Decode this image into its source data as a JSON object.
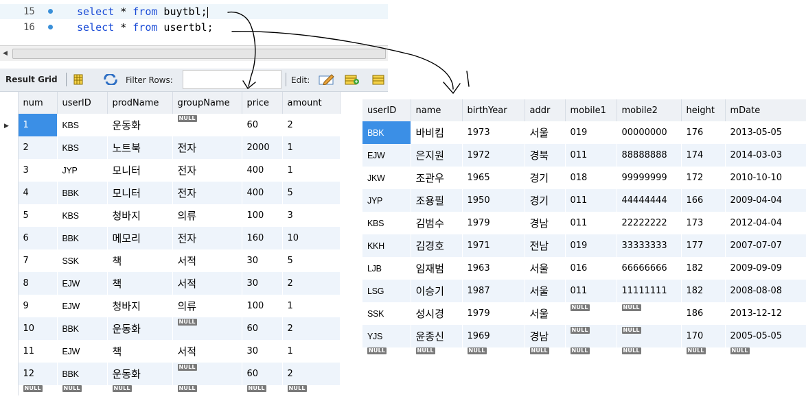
{
  "editor": {
    "lines": [
      {
        "number": "15",
        "keyword": "select",
        "mid": " * ",
        "keyword2": "from",
        "tail": " buytbl;"
      },
      {
        "number": "16",
        "keyword": "select",
        "mid": " * ",
        "keyword2": "from",
        "tail": " usertbl;"
      }
    ]
  },
  "toolbar": {
    "result_grid_label": "Result Grid",
    "filter_rows_label": "Filter Rows:",
    "filter_value": "",
    "edit_label": "Edit:"
  },
  "null_label": "NULL",
  "buytbl": {
    "columns": [
      "num",
      "userID",
      "prodName",
      "groupName",
      "price",
      "amount"
    ],
    "rows": [
      [
        "1",
        "KBS",
        "운동화",
        null,
        "60",
        "2"
      ],
      [
        "2",
        "KBS",
        "노트북",
        "전자",
        "2000",
        "1"
      ],
      [
        "3",
        "JYP",
        "모니터",
        "전자",
        "400",
        "1"
      ],
      [
        "4",
        "BBK",
        "모니터",
        "전자",
        "400",
        "5"
      ],
      [
        "5",
        "KBS",
        "청바지",
        "의류",
        "100",
        "3"
      ],
      [
        "6",
        "BBK",
        "메모리",
        "전자",
        "160",
        "10"
      ],
      [
        "7",
        "SSK",
        "책",
        "서적",
        "30",
        "5"
      ],
      [
        "8",
        "EJW",
        "책",
        "서적",
        "30",
        "2"
      ],
      [
        "9",
        "EJW",
        "청바지",
        "의류",
        "100",
        "1"
      ],
      [
        "10",
        "BBK",
        "운동화",
        null,
        "60",
        "2"
      ],
      [
        "11",
        "EJW",
        "책",
        "서적",
        "30",
        "1"
      ],
      [
        "12",
        "BBK",
        "운동화",
        null,
        "60",
        "2"
      ]
    ]
  },
  "usertbl": {
    "columns": [
      "userID",
      "name",
      "birthYear",
      "addr",
      "mobile1",
      "mobile2",
      "height",
      "mDate"
    ],
    "rows": [
      [
        "BBK",
        "바비킴",
        "1973",
        "서울",
        "019",
        "00000000",
        "176",
        "2013-05-05"
      ],
      [
        "EJW",
        "은지원",
        "1972",
        "경북",
        "011",
        "88888888",
        "174",
        "2014-03-03"
      ],
      [
        "JKW",
        "조관우",
        "1965",
        "경기",
        "018",
        "99999999",
        "172",
        "2010-10-10"
      ],
      [
        "JYP",
        "조용필",
        "1950",
        "경기",
        "011",
        "44444444",
        "166",
        "2009-04-04"
      ],
      [
        "KBS",
        "김범수",
        "1979",
        "경남",
        "011",
        "22222222",
        "173",
        "2012-04-04"
      ],
      [
        "KKH",
        "김경호",
        "1971",
        "전남",
        "019",
        "33333333",
        "177",
        "2007-07-07"
      ],
      [
        "LJB",
        "임재범",
        "1963",
        "서울",
        "016",
        "66666666",
        "182",
        "2009-09-09"
      ],
      [
        "LSG",
        "이승기",
        "1987",
        "서울",
        "011",
        "11111111",
        "182",
        "2008-08-08"
      ],
      [
        "SSK",
        "성시경",
        "1979",
        "서울",
        null,
        null,
        "186",
        "2013-12-12"
      ],
      [
        "YJS",
        "윤종신",
        "1969",
        "경남",
        null,
        null,
        "170",
        "2005-05-05"
      ]
    ]
  },
  "colors": {
    "keyword": "#1a4bd6",
    "selected_cell": "#3b8fe6",
    "row_alt": "#eef4fb",
    "header_bg": "#eef1f5",
    "null_badge": "#7a7a7a",
    "breakpoint": "#3a8fd8"
  },
  "icons": [
    "breakpoint-dot-icon",
    "grid-icon",
    "refresh-icon",
    "edit-pencil-icon",
    "add-row-icon",
    "delete-row-icon",
    "row-pointer-icon"
  ]
}
